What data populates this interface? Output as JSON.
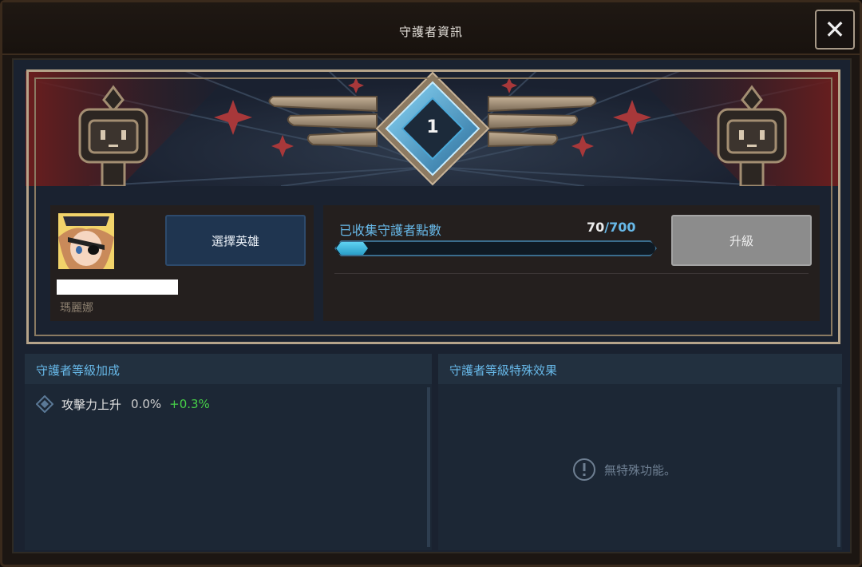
{
  "window": {
    "title": "守護者資訊",
    "close_glyph": "✕"
  },
  "guardian": {
    "level": "1"
  },
  "hero": {
    "select_label": "選擇英雄",
    "name": "瑪麗娜"
  },
  "points": {
    "label": "已收集守護者點數",
    "current": "70",
    "separator": "/",
    "max": "700",
    "progress_fraction": 0.1
  },
  "upgrade": {
    "label": "升級"
  },
  "level_bonus": {
    "title": "守護者等級加成",
    "stats": [
      {
        "name": "攻擊力上升",
        "base": "0.0%",
        "bonus": "+0.3%"
      }
    ]
  },
  "special_effect": {
    "title": "守護者等級特殊效果",
    "empty_message": "無特殊功能。"
  },
  "colors": {
    "accent_blue": "#67b8e8",
    "bonus_green": "#46d048",
    "frame_gold": "#b6a48a",
    "select_blue": "#1f3550",
    "disabled_gray": "#8c8c8c"
  }
}
